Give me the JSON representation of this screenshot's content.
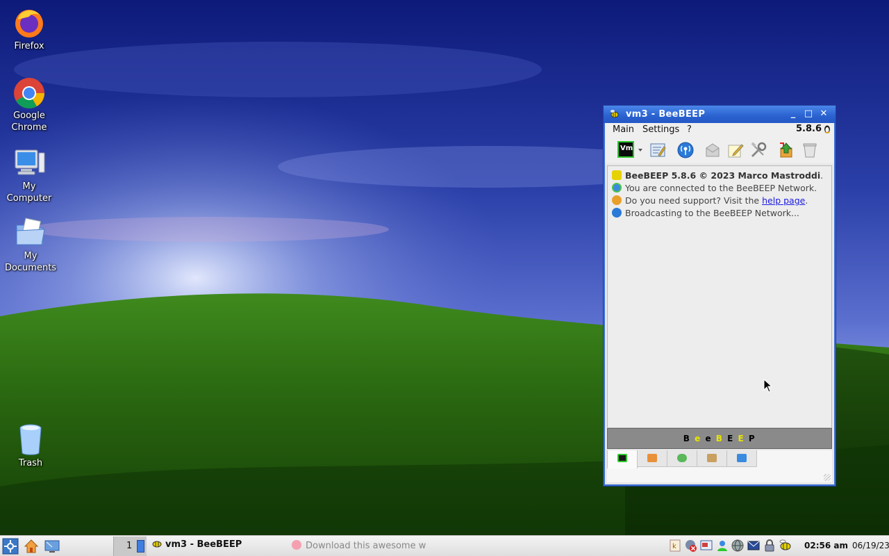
{
  "desktop": {
    "icons": [
      {
        "label_line1": "Firefox",
        "label_line2": ""
      },
      {
        "label_line1": "Google",
        "label_line2": "Chrome"
      },
      {
        "label_line1": "My",
        "label_line2": "Computer"
      },
      {
        "label_line1": "My",
        "label_line2": "Documents"
      },
      {
        "label_line1": "Trash",
        "label_line2": ""
      }
    ]
  },
  "window": {
    "title": "vm3 - BeeBEEP",
    "controls": {
      "minimize": "_",
      "maximize": "□",
      "close": "✕"
    },
    "menu": [
      "Main",
      "Settings",
      "?"
    ],
    "version": "5.8.6",
    "toolbar_icons": [
      "vm-status-icon",
      "dropdown-arrow-icon",
      "edit-profile-icon",
      "broadcast-icon",
      "mail-icon",
      "note-pencil-icon",
      "tools-icon",
      "update-icon",
      "trash-icon"
    ],
    "user_badge": "Vm",
    "log": {
      "line1_strong": "BeeBEEP 5.8.6 © 2023 Marco Mastroddi",
      "line1_tail": ".",
      "line2": "You are connected to the BeeBEEP Network.",
      "line3_pre": "Do you need support? Visit the ",
      "line3_link": "help page",
      "line3_post": ".",
      "line4": "Broadcasting to the BeeBEEP Network..."
    },
    "brand_letters": [
      "B",
      "e",
      "e",
      "B",
      "E",
      "E",
      "P"
    ],
    "brand_colors": [
      "#000000",
      "#e6e600",
      "#000000",
      "#e6e600",
      "#000000",
      "#e6e600",
      "#000000"
    ],
    "tabs": [
      "home-tab-icon",
      "users-tab-icon",
      "chat-tab-icon",
      "groups-tab-icon",
      "shares-tab-icon"
    ]
  },
  "taskbar": {
    "workspace": "1",
    "task_bee": "vm3 - BeeBEEP",
    "task_firefox": "Download this awesome w",
    "clock": "02:56 am",
    "date": "06/19/23"
  },
  "colors": {
    "titlebar": "#2a62d0",
    "accent": "#3d6fd6"
  }
}
